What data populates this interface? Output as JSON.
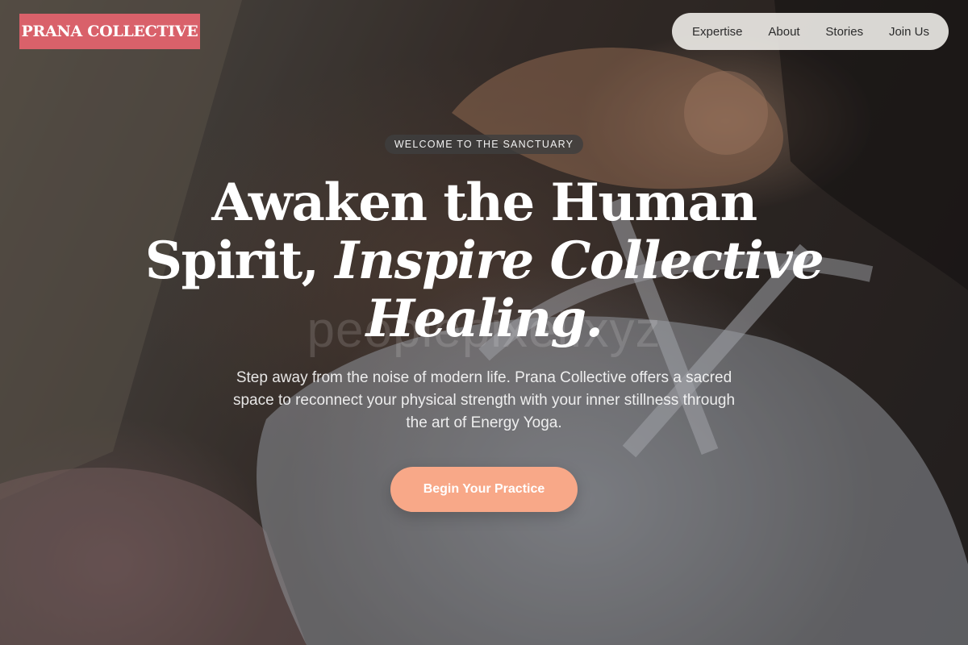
{
  "brand": {
    "name": "PRANA COLLECTIVE",
    "color": "#d9616a"
  },
  "nav": {
    "items": [
      "Expertise",
      "About",
      "Stories",
      "Join Us"
    ]
  },
  "hero": {
    "eyebrow": "WELCOME TO THE SANCTUARY",
    "headline_regular": "Awaken the Human Spirit,",
    "headline_italic": "Inspire Collective Healing.",
    "watermark": "peoplepixel.xyz",
    "subtitle": "Step away from the noise of modern life. Prana Collective offers a sacred space to reconnect your physical strength with your inner stillness through the art of Energy Yoga.",
    "cta_label": "Begin Your Practice",
    "cta_color": "#f8a888"
  }
}
